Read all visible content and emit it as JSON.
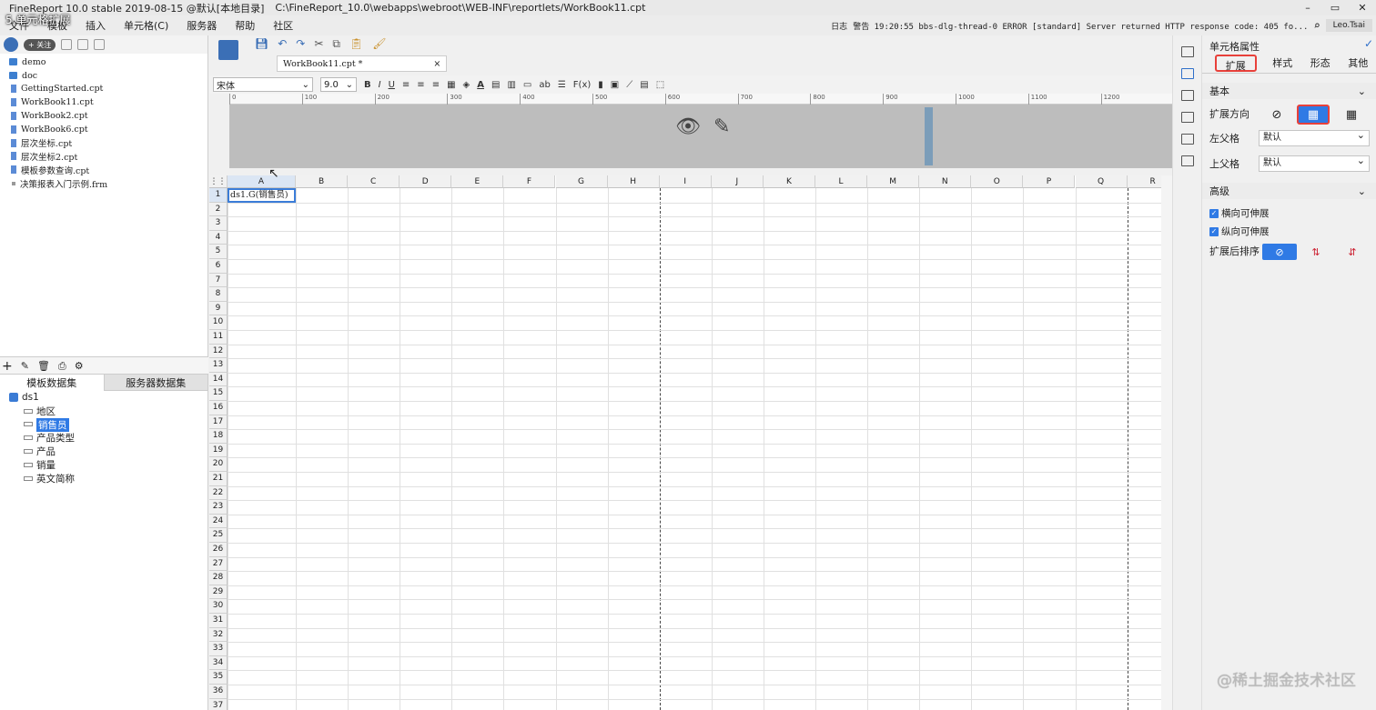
{
  "window": {
    "title": "FineReport 10.0 stable 2019-08-15 @默认[本地目录]",
    "path": "C:\\FineReport_10.0\\webapps\\webroot\\WEB-INF\\reportlets/WorkBook11.cpt",
    "overlay_title": "5.单元格扩展",
    "follow_label": "+ 关注"
  },
  "menu": {
    "items": [
      "文件",
      "模板",
      "插入",
      "单元格(C)",
      "服务器",
      "帮助",
      "社区"
    ],
    "log_label": "日志",
    "log_text": "警告 19:20:55 bbs-dlg-thread-0 ERROR [standard] Server returned HTTP response code: 405 fo...",
    "user": "Leo.Tsai"
  },
  "file_tree": {
    "items": [
      {
        "label": "demo",
        "kind": "folder"
      },
      {
        "label": "doc",
        "kind": "folder"
      },
      {
        "label": "GettingStarted.cpt",
        "kind": "file"
      },
      {
        "label": "WorkBook11.cpt",
        "kind": "file"
      },
      {
        "label": "WorkBook2.cpt",
        "kind": "file"
      },
      {
        "label": "WorkBook6.cpt",
        "kind": "file"
      },
      {
        "label": "层次坐标.cpt",
        "kind": "file"
      },
      {
        "label": "层次坐标2.cpt",
        "kind": "file"
      },
      {
        "label": "模板参数查询.cpt",
        "kind": "file"
      },
      {
        "label": "决策报表入门示例.frm",
        "kind": "frm"
      }
    ]
  },
  "dataset_panel": {
    "tab_template": "模板数据集",
    "tab_server": "服务器数据集",
    "dataset": "ds1",
    "fields": [
      "地区",
      "销售员",
      "产品类型",
      "产品",
      "销量",
      "英文简称"
    ],
    "selected_field": "销售员"
  },
  "doc_tab": {
    "label": "WorkBook11.cpt *",
    "close": "×"
  },
  "format": {
    "font": "宋体",
    "size": "9.0"
  },
  "ruler_ticks": [
    "0",
    "100",
    "200",
    "300",
    "400",
    "500",
    "600",
    "700",
    "800",
    "900",
    "1000",
    "1100",
    "1200"
  ],
  "columns": [
    "A",
    "B",
    "C",
    "D",
    "E",
    "F",
    "G",
    "H",
    "I",
    "J",
    "K",
    "L",
    "M",
    "N",
    "O",
    "P",
    "Q",
    "R"
  ],
  "rows": [
    "1",
    "2",
    "3",
    "4",
    "5",
    "6",
    "7",
    "8",
    "9",
    "10",
    "11",
    "12",
    "13",
    "14",
    "15",
    "16",
    "17",
    "18",
    "19",
    "20",
    "21",
    "22",
    "23",
    "24",
    "25",
    "26",
    "27",
    "28",
    "29",
    "30",
    "31",
    "32",
    "33",
    "34",
    "35",
    "36",
    "37"
  ],
  "cell_a1": "ds1.G(销售员)",
  "props": {
    "title": "单元格属性",
    "tabs": [
      "扩展",
      "样式",
      "形态",
      "其他"
    ],
    "section_basic": "基本",
    "expand_direction_label": "扩展方向",
    "left_parent_label": "左父格",
    "left_parent_value": "默认",
    "up_parent_label": "上父格",
    "up_parent_value": "默认",
    "section_advanced": "高级",
    "horizontal_expandable": "横向可伸展",
    "vertical_expandable": "纵向可伸展",
    "sort_label": "扩展后排序"
  },
  "watermark": "@稀土掘金技术社区",
  "colors": {
    "accent": "#2f7ae5",
    "highlight_border": "#e8403a"
  }
}
